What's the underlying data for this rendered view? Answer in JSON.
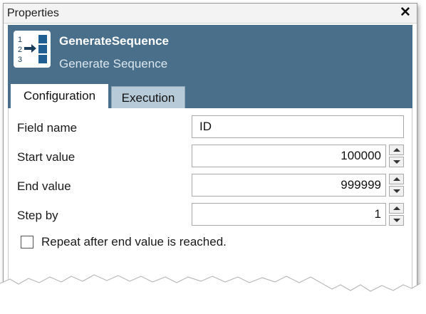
{
  "window": {
    "title": "Properties",
    "close_symbol": "✕"
  },
  "tool": {
    "icon": "generate-sequence-icon",
    "name": "GenerateSequence",
    "description": "Generate Sequence"
  },
  "tabs": [
    {
      "label": "Configuration",
      "active": true
    },
    {
      "label": "Execution",
      "active": false
    }
  ],
  "fields": {
    "field_name": {
      "label": "Field name",
      "value": "ID"
    },
    "start_value": {
      "label": "Start value",
      "value": "100000"
    },
    "end_value": {
      "label": "End value",
      "value": "999999"
    },
    "step_by": {
      "label": "Step by",
      "value": "1"
    }
  },
  "repeat_option": {
    "label": "Repeat after end value is reached.",
    "checked": false
  },
  "colors": {
    "header_bg": "#4a6f8a",
    "inactive_tab_bg": "#b6cad8"
  }
}
